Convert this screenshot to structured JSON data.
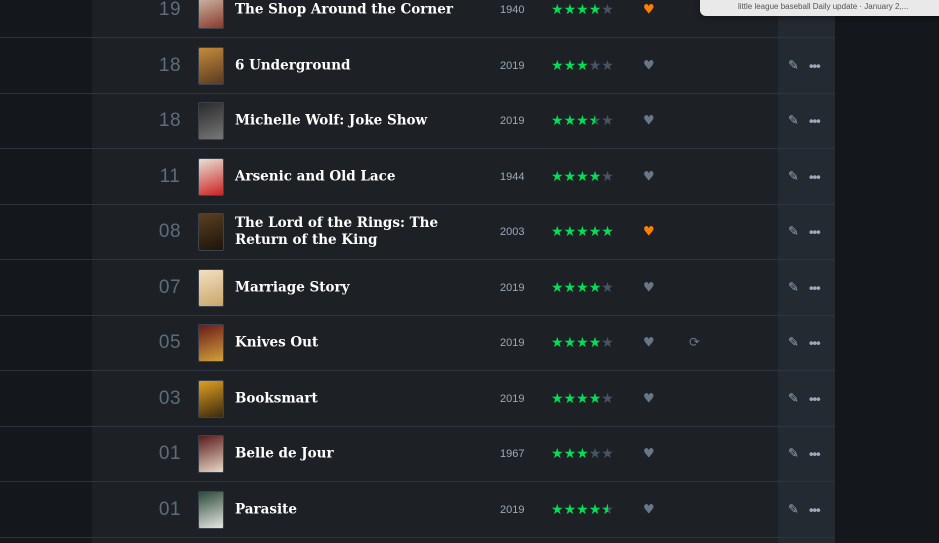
{
  "diary": {
    "entries": [
      {
        "day": "19",
        "title": "The Shop Around the Corner",
        "year": "1940",
        "rating": 4,
        "liked": true,
        "rewatch": false,
        "poster": [
          "#d7c9b8",
          "#8a3a2a"
        ]
      },
      {
        "day": "18",
        "title": "6 Underground",
        "year": "2019",
        "rating": 3,
        "liked": false,
        "rewatch": false,
        "poster": [
          "#c48a3a",
          "#5a3a22"
        ]
      },
      {
        "day": "18",
        "title": "Michelle Wolf: Joke Show",
        "year": "2019",
        "rating": 3.5,
        "liked": false,
        "rewatch": false,
        "poster": [
          "#2a2a2a",
          "#777"
        ]
      },
      {
        "day": "11",
        "title": "Arsenic and Old Lace",
        "year": "1944",
        "rating": 4,
        "liked": false,
        "rewatch": false,
        "poster": [
          "#e7e1d6",
          "#c22"
        ]
      },
      {
        "day": "08",
        "title": "The Lord of the Rings: The Return of the King",
        "year": "2003",
        "rating": 5,
        "liked": true,
        "rewatch": false,
        "poster": [
          "#5a4020",
          "#1c140b"
        ]
      },
      {
        "day": "07",
        "title": "Marriage Story",
        "year": "2019",
        "rating": 4,
        "liked": false,
        "rewatch": false,
        "poster": [
          "#f2e0c2",
          "#c9a56a"
        ]
      },
      {
        "day": "05",
        "title": "Knives Out",
        "year": "2019",
        "rating": 4,
        "liked": false,
        "rewatch": true,
        "poster": [
          "#6a1a1a",
          "#d2a13a"
        ]
      },
      {
        "day": "03",
        "title": "Booksmart",
        "year": "2019",
        "rating": 4,
        "liked": false,
        "rewatch": false,
        "poster": [
          "#e0a020",
          "#3a2a10"
        ]
      },
      {
        "day": "01",
        "title": "Belle de Jour",
        "year": "1967",
        "rating": 3,
        "liked": false,
        "rewatch": false,
        "poster": [
          "#5a1a1a",
          "#e8d8c8"
        ]
      },
      {
        "day": "01",
        "title": "Parasite",
        "year": "2019",
        "rating": 4.5,
        "liked": false,
        "rewatch": false,
        "poster": [
          "#2a4a3a",
          "#e8e8e0"
        ]
      }
    ]
  },
  "notification": {
    "text": "little league baseball Daily update · January 2,..."
  },
  "colors": {
    "star": "#00e054",
    "liked": "#ff8000",
    "background": "#14181c",
    "panel": "#1d2126"
  },
  "icons": {
    "like": "heart-icon",
    "rewatch": "rewatch-icon",
    "edit": "pencil-icon",
    "more": "more-icon"
  }
}
